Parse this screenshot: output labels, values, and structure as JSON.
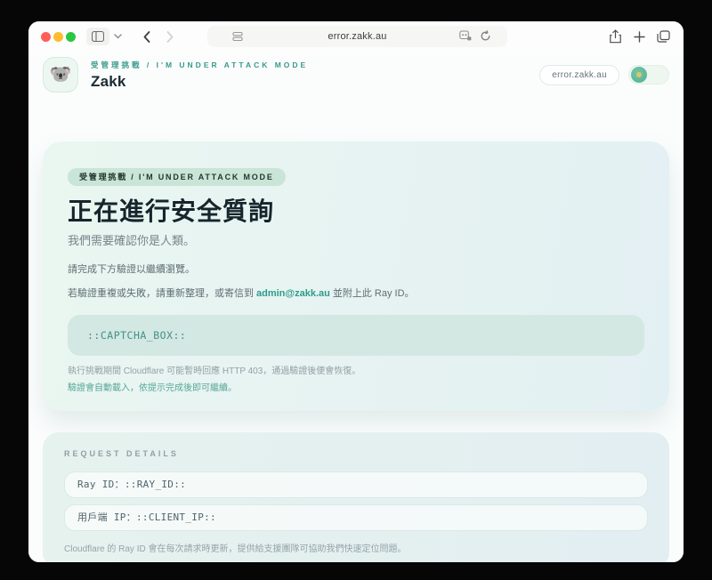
{
  "browser": {
    "url": "error.zakk.au"
  },
  "header": {
    "avatar_emoji": "🐨",
    "eyebrow": "受管理挑戰 / I'M UNDER ATTACK MODE",
    "site_name": "Zakk",
    "domain_pill": "error.zakk.au"
  },
  "challenge_card": {
    "badge": "受管理挑戰 / I'M UNDER ATTACK MODE",
    "title": "正在進行安全質詢",
    "subtitle": "我們需要確認你是人類。",
    "instruction": "請完成下方驗證以繼續瀏覽。",
    "fallback_prefix": "若驗證重複或失敗，請重新整理，或寄信到",
    "email": "admin@zakk.au",
    "fallback_suffix": "並附上此 Ray ID。",
    "captcha_placeholder": "::CAPTCHA_BOX::",
    "note_http": "執行挑戰期間 Cloudflare 可能暫時回應 HTTP 403，通過驗證後便會恢復。",
    "note_auto": "驗證會自動載入，依提示完成後即可繼續。"
  },
  "details_card": {
    "label": "REQUEST DETAILS",
    "fields": [
      {
        "label": "Ray ID：",
        "value": "::RAY_ID::"
      },
      {
        "label": "用戶端 IP：",
        "value": "::CLIENT_IP::"
      }
    ],
    "note": "Cloudflare 的 Ray ID 會在每次請求時更新，提供給支援團隊可協助我們快速定位問題。"
  },
  "colors": {
    "accent_teal": "#2d9c8b",
    "card_mint": "#eaf6f0",
    "card_blue": "#e3f0f3",
    "captcha_bg": "#d3e7e3",
    "badge_bg": "#c9e5d7",
    "traffic_red": "#ff5f57",
    "traffic_yellow": "#febc2e",
    "traffic_green": "#28c840"
  }
}
